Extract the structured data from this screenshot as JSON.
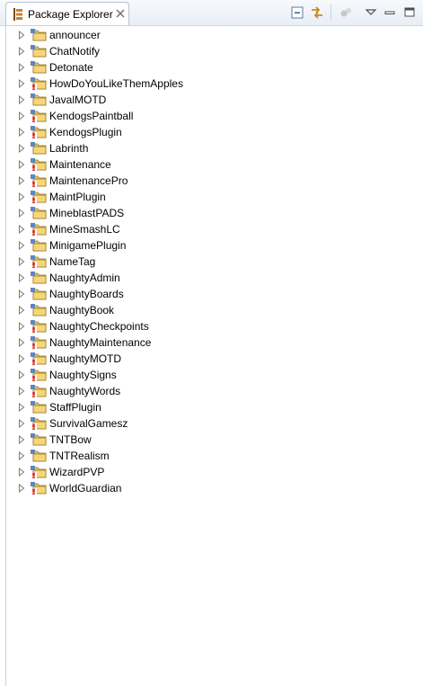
{
  "view": {
    "tab_label": "Package Explorer",
    "icons": {
      "tab": "package-explorer-icon",
      "close": "close-icon",
      "collapse_all": "collapse-all-icon",
      "link_with_editor": "link-with-editor-icon",
      "focus": "focus-active-task-icon",
      "view_menu": "view-menu-icon",
      "minimize": "minimize-icon",
      "maximize": "maximize-icon"
    }
  },
  "colors": {
    "folder": "#e8c35a",
    "error": "#d8261c",
    "selection_border": "#c9d3df"
  },
  "projects": [
    {
      "name": "announcer",
      "error": false
    },
    {
      "name": "ChatNotify",
      "error": false
    },
    {
      "name": "Detonate",
      "error": false
    },
    {
      "name": "HowDoYouLikeThemApples",
      "error": true
    },
    {
      "name": "JavalMOTD",
      "error": false
    },
    {
      "name": "KendogsPaintball",
      "error": true
    },
    {
      "name": "KendogsPlugin",
      "error": true
    },
    {
      "name": "Labrinth",
      "error": false
    },
    {
      "name": "Maintenance",
      "error": true
    },
    {
      "name": "MaintenancePro",
      "error": true
    },
    {
      "name": "MaintPlugin",
      "error": true
    },
    {
      "name": "MineblastPADS",
      "error": false
    },
    {
      "name": "MineSmashLC",
      "error": true
    },
    {
      "name": "MinigamePlugin",
      "error": false
    },
    {
      "name": "NameTag",
      "error": true
    },
    {
      "name": "NaughtyAdmin",
      "error": false
    },
    {
      "name": "NaughtyBoards",
      "error": false
    },
    {
      "name": "NaughtyBook",
      "error": false
    },
    {
      "name": "NaughtyCheckpoints",
      "error": true
    },
    {
      "name": "NaughtyMaintenance",
      "error": true
    },
    {
      "name": "NaughtyMOTD",
      "error": true
    },
    {
      "name": "NaughtySigns",
      "error": true
    },
    {
      "name": "NaughtyWords",
      "error": true
    },
    {
      "name": "StaffPlugin",
      "error": false
    },
    {
      "name": "SurvivalGamesz",
      "error": true
    },
    {
      "name": "TNTBow",
      "error": false
    },
    {
      "name": "TNTRealism",
      "error": false
    },
    {
      "name": "WizardPVP",
      "error": true
    },
    {
      "name": "WorldGuardian",
      "error": true
    }
  ]
}
